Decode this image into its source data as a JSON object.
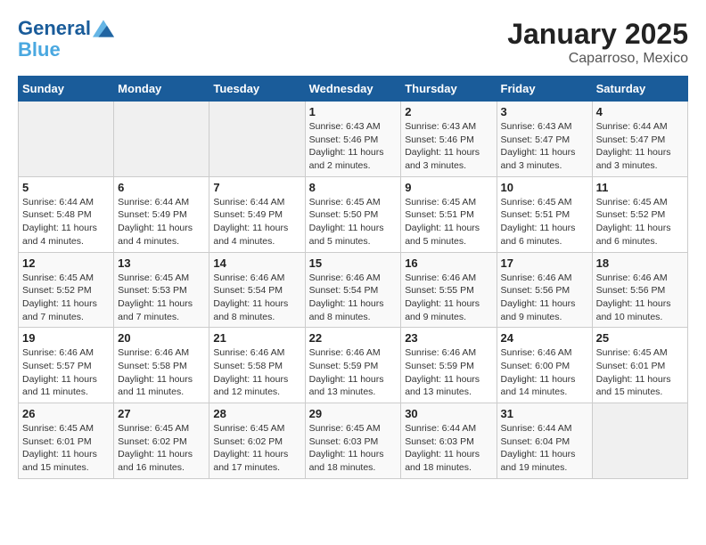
{
  "header": {
    "logo_line1": "General",
    "logo_line2": "Blue",
    "month_year": "January 2025",
    "location": "Caparroso, Mexico"
  },
  "weekdays": [
    "Sunday",
    "Monday",
    "Tuesday",
    "Wednesday",
    "Thursday",
    "Friday",
    "Saturday"
  ],
  "weeks": [
    [
      {
        "day": "",
        "info": ""
      },
      {
        "day": "",
        "info": ""
      },
      {
        "day": "",
        "info": ""
      },
      {
        "day": "1",
        "info": "Sunrise: 6:43 AM\nSunset: 5:46 PM\nDaylight: 11 hours and 2 minutes."
      },
      {
        "day": "2",
        "info": "Sunrise: 6:43 AM\nSunset: 5:46 PM\nDaylight: 11 hours and 3 minutes."
      },
      {
        "day": "3",
        "info": "Sunrise: 6:43 AM\nSunset: 5:47 PM\nDaylight: 11 hours and 3 minutes."
      },
      {
        "day": "4",
        "info": "Sunrise: 6:44 AM\nSunset: 5:47 PM\nDaylight: 11 hours and 3 minutes."
      }
    ],
    [
      {
        "day": "5",
        "info": "Sunrise: 6:44 AM\nSunset: 5:48 PM\nDaylight: 11 hours and 4 minutes."
      },
      {
        "day": "6",
        "info": "Sunrise: 6:44 AM\nSunset: 5:49 PM\nDaylight: 11 hours and 4 minutes."
      },
      {
        "day": "7",
        "info": "Sunrise: 6:44 AM\nSunset: 5:49 PM\nDaylight: 11 hours and 4 minutes."
      },
      {
        "day": "8",
        "info": "Sunrise: 6:45 AM\nSunset: 5:50 PM\nDaylight: 11 hours and 5 minutes."
      },
      {
        "day": "9",
        "info": "Sunrise: 6:45 AM\nSunset: 5:51 PM\nDaylight: 11 hours and 5 minutes."
      },
      {
        "day": "10",
        "info": "Sunrise: 6:45 AM\nSunset: 5:51 PM\nDaylight: 11 hours and 6 minutes."
      },
      {
        "day": "11",
        "info": "Sunrise: 6:45 AM\nSunset: 5:52 PM\nDaylight: 11 hours and 6 minutes."
      }
    ],
    [
      {
        "day": "12",
        "info": "Sunrise: 6:45 AM\nSunset: 5:52 PM\nDaylight: 11 hours and 7 minutes."
      },
      {
        "day": "13",
        "info": "Sunrise: 6:45 AM\nSunset: 5:53 PM\nDaylight: 11 hours and 7 minutes."
      },
      {
        "day": "14",
        "info": "Sunrise: 6:46 AM\nSunset: 5:54 PM\nDaylight: 11 hours and 8 minutes."
      },
      {
        "day": "15",
        "info": "Sunrise: 6:46 AM\nSunset: 5:54 PM\nDaylight: 11 hours and 8 minutes."
      },
      {
        "day": "16",
        "info": "Sunrise: 6:46 AM\nSunset: 5:55 PM\nDaylight: 11 hours and 9 minutes."
      },
      {
        "day": "17",
        "info": "Sunrise: 6:46 AM\nSunset: 5:56 PM\nDaylight: 11 hours and 9 minutes."
      },
      {
        "day": "18",
        "info": "Sunrise: 6:46 AM\nSunset: 5:56 PM\nDaylight: 11 hours and 10 minutes."
      }
    ],
    [
      {
        "day": "19",
        "info": "Sunrise: 6:46 AM\nSunset: 5:57 PM\nDaylight: 11 hours and 11 minutes."
      },
      {
        "day": "20",
        "info": "Sunrise: 6:46 AM\nSunset: 5:58 PM\nDaylight: 11 hours and 11 minutes."
      },
      {
        "day": "21",
        "info": "Sunrise: 6:46 AM\nSunset: 5:58 PM\nDaylight: 11 hours and 12 minutes."
      },
      {
        "day": "22",
        "info": "Sunrise: 6:46 AM\nSunset: 5:59 PM\nDaylight: 11 hours and 13 minutes."
      },
      {
        "day": "23",
        "info": "Sunrise: 6:46 AM\nSunset: 5:59 PM\nDaylight: 11 hours and 13 minutes."
      },
      {
        "day": "24",
        "info": "Sunrise: 6:46 AM\nSunset: 6:00 PM\nDaylight: 11 hours and 14 minutes."
      },
      {
        "day": "25",
        "info": "Sunrise: 6:45 AM\nSunset: 6:01 PM\nDaylight: 11 hours and 15 minutes."
      }
    ],
    [
      {
        "day": "26",
        "info": "Sunrise: 6:45 AM\nSunset: 6:01 PM\nDaylight: 11 hours and 15 minutes."
      },
      {
        "day": "27",
        "info": "Sunrise: 6:45 AM\nSunset: 6:02 PM\nDaylight: 11 hours and 16 minutes."
      },
      {
        "day": "28",
        "info": "Sunrise: 6:45 AM\nSunset: 6:02 PM\nDaylight: 11 hours and 17 minutes."
      },
      {
        "day": "29",
        "info": "Sunrise: 6:45 AM\nSunset: 6:03 PM\nDaylight: 11 hours and 18 minutes."
      },
      {
        "day": "30",
        "info": "Sunrise: 6:44 AM\nSunset: 6:03 PM\nDaylight: 11 hours and 18 minutes."
      },
      {
        "day": "31",
        "info": "Sunrise: 6:44 AM\nSunset: 6:04 PM\nDaylight: 11 hours and 19 minutes."
      },
      {
        "day": "",
        "info": ""
      }
    ]
  ]
}
